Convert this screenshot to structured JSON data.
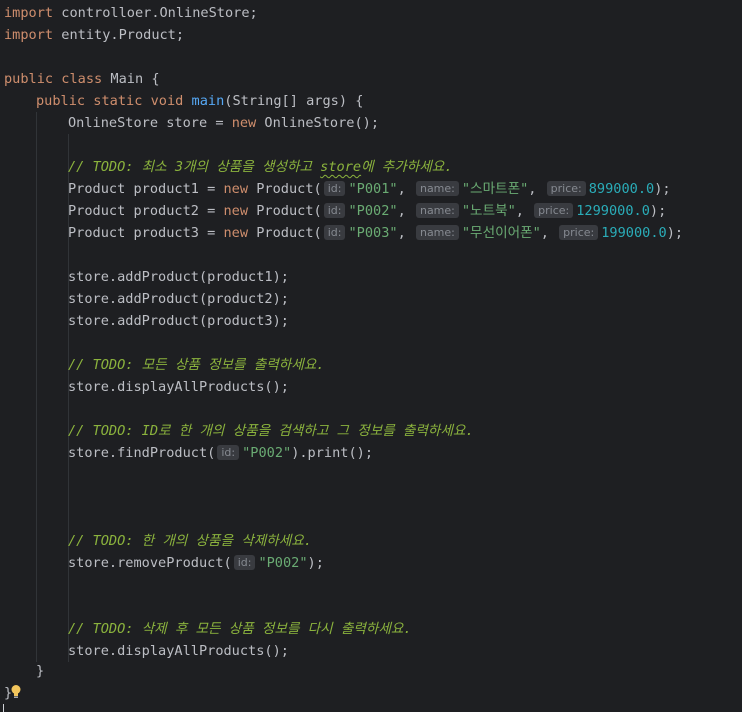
{
  "code": {
    "l1": {
      "kw": "import",
      "rest": " controlloer.OnlineStore;"
    },
    "l2": {
      "kw": "import",
      "rest": " entity.Product;"
    },
    "l4": {
      "kw": "public class",
      "rest": " Main {"
    },
    "l5": {
      "kw": "public static void",
      "fn": "main",
      "rest": "(String[] args) {"
    },
    "l6": {
      "a": "OnlineStore store = ",
      "kw": "new",
      "b": " OnlineStore();"
    },
    "l8": {
      "a": "// TODO:",
      "b": " 최소 3개의 상품을 생성하고 ",
      "c": "store",
      "d": "에 추가하세요."
    },
    "products": [
      {
        "decl": "Product product1 = ",
        "kw": "new",
        "ctor": " Product(",
        "hint_id": "id:",
        "id": "\"P001\"",
        "hint_name": "name:",
        "name": "\"스마트폰\"",
        "hint_price": "price:",
        "price": "899000.0",
        "end": ");"
      },
      {
        "decl": "Product product2 = ",
        "kw": "new",
        "ctor": " Product(",
        "hint_id": "id:",
        "id": "\"P002\"",
        "hint_name": "name:",
        "name": "\"노트북\"",
        "hint_price": "price:",
        "price": "1299000.0",
        "end": ");"
      },
      {
        "decl": "Product product3 = ",
        "kw": "new",
        "ctor": " Product(",
        "hint_id": "id:",
        "id": "\"P003\"",
        "hint_name": "name:",
        "name": "\"무선이어폰\"",
        "hint_price": "price:",
        "price": "199000.0",
        "end": ");"
      }
    ],
    "add1": "store.addProduct(product1);",
    "add2": "store.addProduct(product2);",
    "add3": "store.addProduct(product3);",
    "todo2": "// TODO: 모든 상품 정보를 출력하세요.",
    "display1": "store.displayAllProducts();",
    "todo3": "// TODO: ID로 한 개의 상품을 검색하고 그 정보를 출력하세요.",
    "find": {
      "a": "store.findProduct(",
      "hint": "id:",
      "str": "\"P002\"",
      "b": ").print();"
    },
    "todo4": "// TODO: 한 개의 상품을 삭제하세요.",
    "remove": {
      "a": "store.removeProduct(",
      "hint": "id:",
      "str": "\"P002\"",
      "b": ");"
    },
    "todo5": "// TODO: 삭제 후 모든 상품 정보를 다시 출력하세요.",
    "display2": "store.displayAllProducts();",
    "close_method": "}",
    "close_class": "}"
  },
  "icons": {
    "bulb": "lightbulb-icon"
  },
  "colors": {
    "keyword": "#cf8e6d",
    "function": "#56a8f5",
    "string": "#6aab73",
    "number": "#2aacb8",
    "todo": "#8bb33d",
    "background": "#1e1f22"
  }
}
